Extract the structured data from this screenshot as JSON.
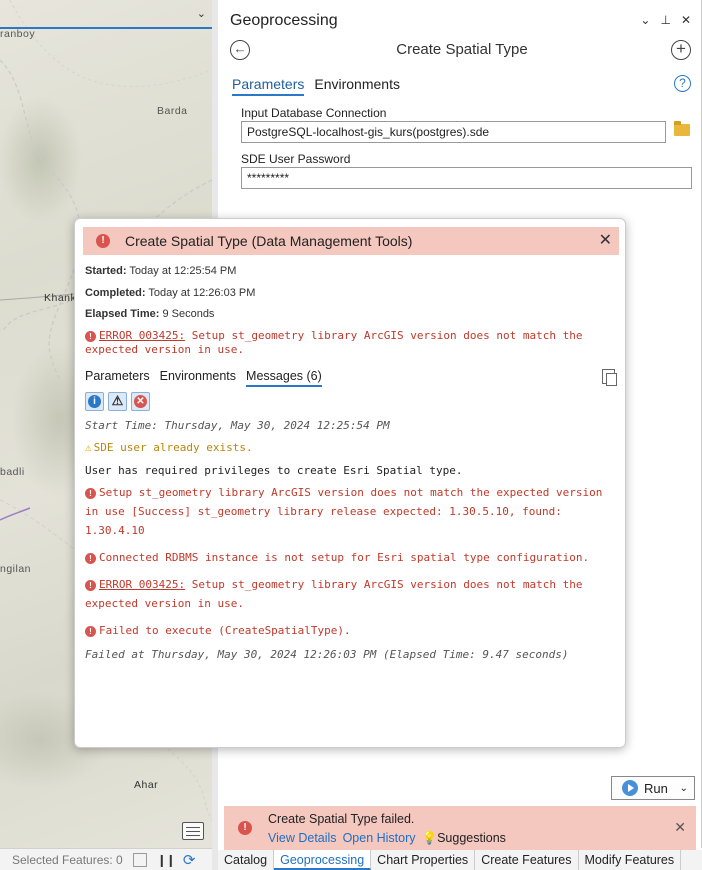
{
  "map": {
    "labels": [
      "ranboy",
      "Barda",
      "Khank",
      "badli",
      "ngilan",
      "Ahar"
    ],
    "status": {
      "selected_features": "Selected Features: 0"
    }
  },
  "pane": {
    "title": "Geoprocessing",
    "controls": [
      "⌄",
      "⊥",
      "✕"
    ],
    "tool_title": "Create Spatial Type",
    "tabs": [
      "Parameters",
      "Environments"
    ],
    "params": {
      "db_label": "Input Database Connection",
      "db_value": "PostgreSQL-localhost-gis_kurs(postgres).sde",
      "pwd_label": "SDE User Password",
      "pwd_value": "*********"
    },
    "run_label": "Run",
    "failed": {
      "message": "Create Spatial Type failed.",
      "view_details": "View Details",
      "open_history": "Open History",
      "suggestions": "Suggestions"
    },
    "bottom_tabs": [
      "Catalog",
      "Geoprocessing",
      "Chart Properties",
      "Create Features",
      "Modify Features"
    ]
  },
  "dialog": {
    "title": "Create Spatial Type (Data Management Tools)",
    "started_label": "Started:",
    "started_value": "Today at 12:25:54 PM",
    "completed_label": "Completed:",
    "completed_value": "Today at 12:26:03 PM",
    "elapsed_label": "Elapsed Time:",
    "elapsed_value": "9 Seconds",
    "top_error_code": "ERROR 003425:",
    "top_error_text": " Setup st_geometry library ArcGIS version does not match the expected version in use.",
    "tabs": [
      "Parameters",
      "Environments",
      "Messages (6)"
    ],
    "messages": {
      "start_time": "Start Time: Thursday, May 30, 2024 12:25:54 PM",
      "warning": "SDE user already exists.",
      "info": "User has required privileges to create Esri Spatial type.",
      "error1": "Setup st_geometry library ArcGIS version does not match the expected version in use [Success] st_geometry library release expected: 1.30.5.10, found: 1.30.4.10",
      "error2": "Connected RDBMS instance is not setup for Esri spatial type configuration.",
      "error3_code": "ERROR 003425:",
      "error3_text": " Setup st_geometry library ArcGIS version does not match the expected version in use.",
      "error4": "Failed to execute (CreateSpatialType).",
      "end": "Failed at Thursday, May 30, 2024 12:26:03 PM (Elapsed Time: 9.47 seconds)"
    }
  },
  "colors": {
    "accent": "#2a79c8",
    "error": "#d9534f",
    "error_banner": "#f4c7bf",
    "warning": "#e0a800"
  }
}
